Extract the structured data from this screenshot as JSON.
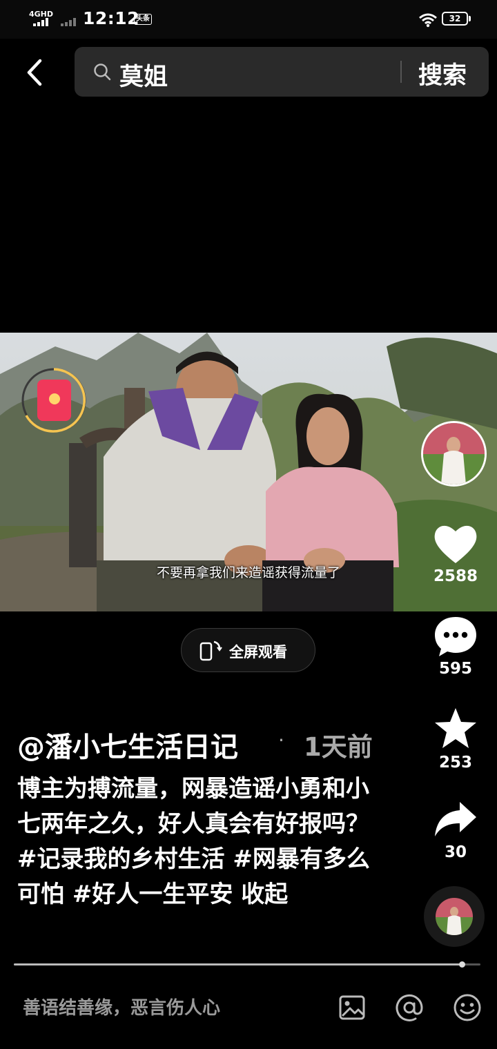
{
  "status_bar": {
    "network": "4GHD",
    "time": "12:12",
    "app_badge": "头条",
    "battery": "32"
  },
  "search": {
    "query": "莫姐",
    "button_label": "搜索"
  },
  "video": {
    "subtitle": "不要再拿我们来造谣获得流量了",
    "progress": 0.96
  },
  "actions": {
    "likes": "2588",
    "comments": "595",
    "favorites": "253",
    "shares": "30"
  },
  "fullscreen": {
    "label": "全屏观看"
  },
  "post": {
    "author": "@潘小七生活日记",
    "separator": "·",
    "time": "1天前",
    "caption_text": "博主为搏流量，网暴造谣小勇和小七两年之久，好人真会有好报吗？ ",
    "tags": [
      "#记录我的乡村生活",
      "#网暴有多么可怕",
      "#好人一生平安"
    ],
    "collapse": "收起"
  },
  "comment": {
    "placeholder": "善语结善缘，恶言伤人心"
  },
  "icons": {
    "back": "chevron-left-icon",
    "search": "search-icon",
    "like": "heart-icon",
    "comment": "comment-icon",
    "favorite": "star-icon",
    "share": "share-icon",
    "fullscreen": "rotate-phone-icon",
    "image": "image-icon",
    "mention": "at-icon",
    "emoji": "emoji-icon"
  },
  "colors": {
    "background": "#000000",
    "search_box": "#2a2a2a",
    "red_packet": "#f0385a",
    "ring": "#f5c451",
    "muted_text": "#aaaaaa"
  }
}
